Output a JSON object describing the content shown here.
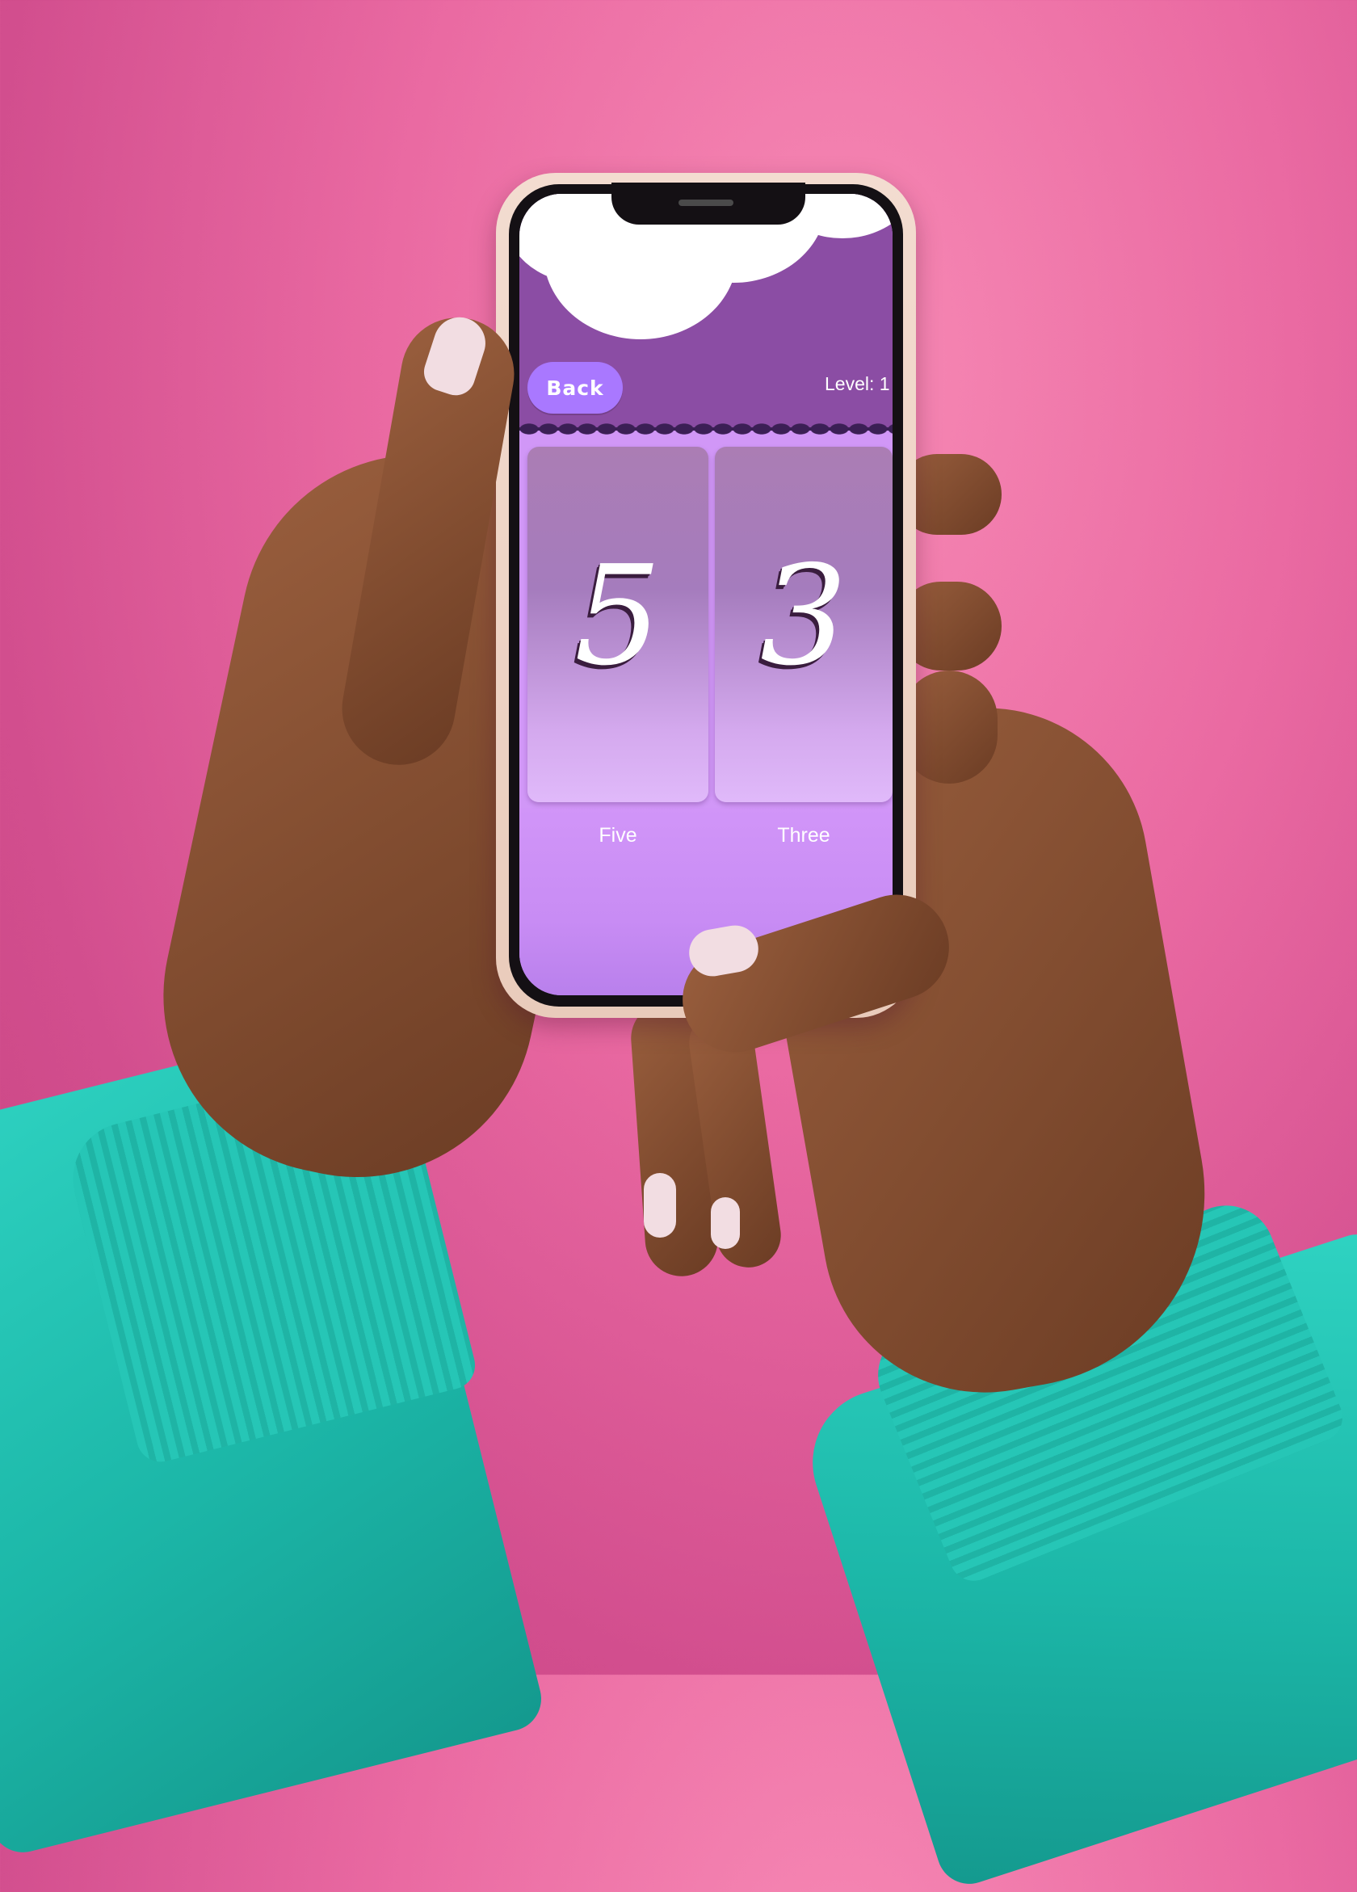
{
  "app": {
    "back_label": "Back",
    "level_label": "Level: 1"
  },
  "cards": [
    {
      "digit": "5",
      "word": "Five"
    },
    {
      "digit": "3",
      "word": "Three"
    }
  ],
  "colors": {
    "background": "#ea6aa2",
    "top_bar": "#8b4da4",
    "back_button": "#a978ff",
    "card_top": "#ab7db4",
    "card_bottom": "#e0b9fa",
    "screen_bottom": "#d195f8",
    "sleeve": "#1fb4a5"
  },
  "icons": [
    "cloud-shape",
    "chain-divider"
  ]
}
